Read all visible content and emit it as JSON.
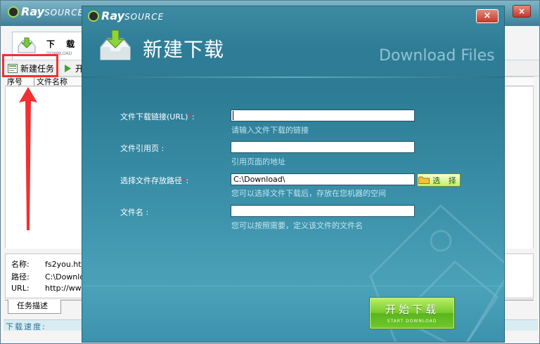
{
  "main_window": {
    "logo": {
      "ray": "Ray",
      "source": "SOURCE"
    },
    "tab": {
      "title": "下 载",
      "subtitle": "DOWNLOAD"
    },
    "toolbar": {
      "new_task": "新建任务",
      "start": "开"
    },
    "columns": [
      "序号",
      "文件名称"
    ],
    "details": [
      {
        "label": "名称:",
        "value": "fs2you.htm"
      },
      {
        "label": "路径:",
        "value": "C:\\Downlo"
      },
      {
        "label": "URL:",
        "value": "http://ww"
      }
    ],
    "detail_tab": "任务描述",
    "status": {
      "speed_label": "下载速度:"
    },
    "colors": {
      "highlight": "#f23030",
      "arrow": "#f23030"
    }
  },
  "dialog": {
    "logo": {
      "ray": "Ray",
      "source": "SOURCE"
    },
    "close_label": "×",
    "title": "新建下载",
    "subtitle": "Download Files",
    "fields": {
      "url": {
        "label_main": "文件下载链接(URL)",
        "required": "*",
        "label_end": ":",
        "value": "",
        "hint": "请输入文件下载的链接"
      },
      "referrer": {
        "label": "文件引用页 :",
        "value": "",
        "hint": "引用页面的地址"
      },
      "save_path": {
        "label_main": "选择文件存放路径",
        "required": "*",
        "label_end": ":",
        "value": "C:\\Download\\",
        "hint": "您可以选择文件下载后，存放在您机器的空间"
      },
      "filename": {
        "label": "文件名 :",
        "value": "",
        "hint": "您可以按照需要，定义该文件的文件名"
      }
    },
    "choose_button": "选 择",
    "start_button": {
      "main": "开始下载",
      "sub": "START DOWNLOAD"
    },
    "colors": {
      "accent_green": "#79cc2b",
      "dialog_bg": "#2f7c96",
      "required": "#ff2e2e"
    }
  }
}
